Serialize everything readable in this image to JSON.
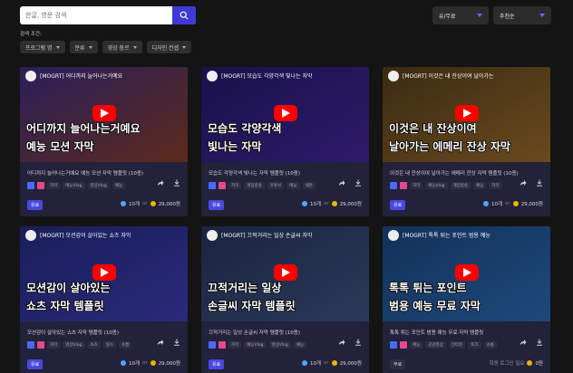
{
  "search": {
    "placeholder": "한글, 영문 검색"
  },
  "filters": {
    "price_label": "유/무료",
    "sort_label": "추천순"
  },
  "conditions_label": "검색 조건:",
  "chips": [
    "프로그램 명",
    "분류",
    "영상 장르",
    "디자인 컨셉"
  ],
  "cards": [
    {
      "header": "[MOGRT] 어디까지 늘어나는거예요",
      "lines": [
        "어디까지 늘어나는거예요",
        "예능 모션 자막"
      ],
      "title": "어디까지 늘어나는거예요 예능 모션 자막 템플릿 (10종)",
      "tags": [
        "자막",
        "예능Vlog",
        "영상Vlog",
        "예능"
      ],
      "badge": "유료",
      "count": "10개",
      "or": "or",
      "price": "29,000원",
      "colors": [
        "#2a1f5a",
        "#5c2a1c"
      ]
    },
    {
      "header": "[MOGRT] 모습도 각양각색 빛나는 자막",
      "lines": [
        "모습도 각양각색",
        "빛나는 자막"
      ],
      "title": "모습도 각양각색 빛나는 자막 템플릿 (10종)",
      "tags": [
        "자막",
        "게임방송",
        "유튜브",
        "예능",
        "네온"
      ],
      "badge": "유료",
      "count": "10개",
      "or": "or",
      "price": "29,000원",
      "colors": [
        "#18124a",
        "#2e1a6a"
      ]
    },
    {
      "header": "[MOGRT] 이것은 내 잔상이여 날아가는",
      "lines": [
        "이것은 내 잔상이여",
        "날아가는 에메리 잔상 자막"
      ],
      "title": "이것은 내 잔상이여 날아가는 에메리 잔상 자막 템플릿 (10종)",
      "tags": [
        "자막",
        "예능Vlog",
        "게임방송",
        "예능",
        "자막"
      ],
      "badge": "유료",
      "count": "10개",
      "or": "or",
      "price": "29,000원",
      "colors": [
        "#3a2a14",
        "#6a4a1c"
      ]
    },
    {
      "header": "[MOGRT] 모션감이 살아있는 쇼츠 자막",
      "lines": [
        "모션감이 살아있는",
        "쇼츠 자막 템플릿"
      ],
      "title": "모션감이 살아있는 쇼츠 자막 템플릿 (10종)",
      "tags": [
        "자막",
        "영상Vlog",
        "쇼츠",
        "릴스",
        "숏폼"
      ],
      "badge": "유료",
      "count": "10개",
      "or": "or",
      "price": "29,000원",
      "colors": [
        "#1a1e5a",
        "#2a2a7a"
      ]
    },
    {
      "header": "[MOGRT] 끄적거리는 일상 손글씨 자막",
      "lines": [
        "끄적거리는 일상",
        "손글씨 자막 템플릿"
      ],
      "title": "끄적거리는 일상 손글씨 자막 템플릿 (10종)",
      "tags": [
        "자막",
        "예능Vlog",
        "영상Vlog",
        "예능"
      ],
      "badge": "유료",
      "count": "10개",
      "or": "or",
      "price": "29,000원",
      "colors": [
        "#1a2440",
        "#2a3a5a"
      ]
    },
    {
      "header": "[MOGRT] 톡톡 튀는 포인트 범용 예능",
      "lines": [
        "톡톡 튀는 포인트",
        "범용 예능 무료 자막"
      ],
      "title": "톡톡 튀는 포인트 범용 예능 무료 자막 템플릿",
      "tags": [
        "예능",
        "공감영상",
        "인터뷰",
        "토크",
        "소통"
      ],
      "badge": "무료",
      "count": "0원",
      "or": "",
      "price": "",
      "extra": "회원 로그인 필요",
      "colors": [
        "#14305a",
        "#1c4a7a"
      ]
    }
  ]
}
